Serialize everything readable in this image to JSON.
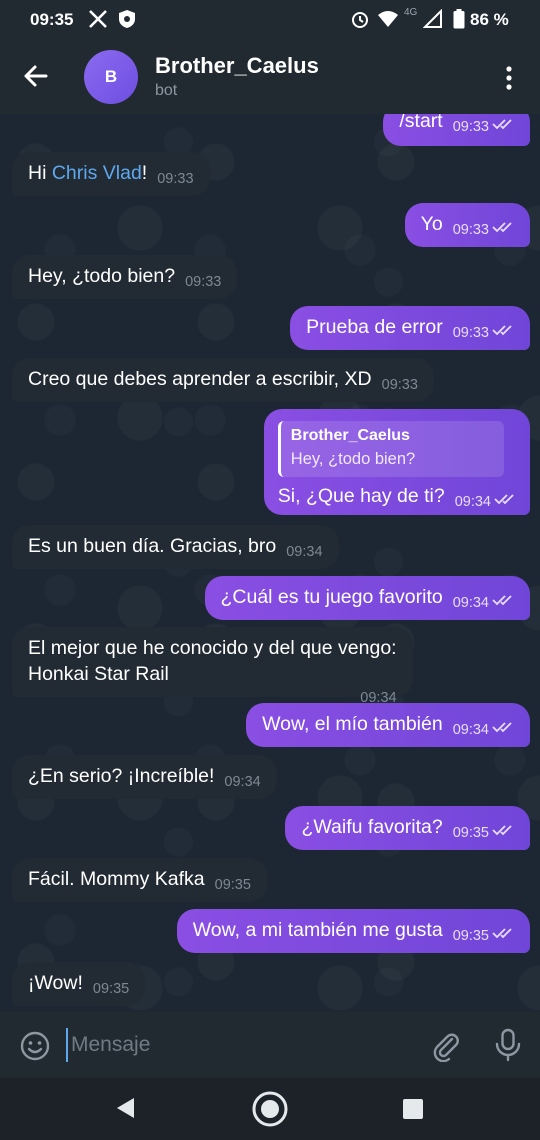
{
  "status_bar": {
    "time": "09:35",
    "network_label": "4G",
    "battery": "86 %"
  },
  "header": {
    "avatar_initial": "B",
    "title": "Brother_Caelus",
    "subtitle": "bot"
  },
  "messages": [
    {
      "dir": "out",
      "text": "/start",
      "time": "09:33",
      "read": true
    },
    {
      "dir": "in",
      "prefix": "Hi ",
      "mention": "Chris Vlad",
      "suffix": "!",
      "time": "09:33"
    },
    {
      "dir": "out",
      "text": "Yo",
      "time": "09:33",
      "read": true
    },
    {
      "dir": "in",
      "text": "Hey, ¿todo bien?",
      "time": "09:33"
    },
    {
      "dir": "out",
      "text": "Prueba de error",
      "time": "09:33",
      "read": true
    },
    {
      "dir": "in",
      "text": "Creo que debes aprender a escribir, XD",
      "time": "09:33"
    },
    {
      "dir": "out",
      "reply_name": "Brother_Caelus",
      "reply_text": "Hey, ¿todo bien?",
      "text": "Si, ¿Que hay de ti?",
      "time": "09:34",
      "read": true
    },
    {
      "dir": "in",
      "text": "Es un buen día. Gracias, bro",
      "time": "09:34"
    },
    {
      "dir": "out",
      "text": "¿Cuál es tu juego favorito",
      "time": "09:34",
      "read": true
    },
    {
      "dir": "in",
      "line1": "El mejor que he conocido y del que vengo:",
      "line2": "Honkai Star Rail",
      "time": "09:34"
    },
    {
      "dir": "out",
      "text": "Wow, el mío también",
      "time": "09:34",
      "read": true
    },
    {
      "dir": "in",
      "text": "¿En serio? ¡Increíble!",
      "time": "09:34"
    },
    {
      "dir": "out",
      "text": "¿Waifu favorita?",
      "time": "09:35",
      "read": true
    },
    {
      "dir": "in",
      "text": "Fácil. Mommy Kafka",
      "time": "09:35"
    },
    {
      "dir": "out",
      "text": "Wow, a mi también me gusta",
      "time": "09:35",
      "read": true
    },
    {
      "dir": "in",
      "text": "¡Wow!",
      "time": "09:35"
    }
  ],
  "input": {
    "placeholder": "Mensaje"
  },
  "icons": {
    "back": "arrow-left-icon",
    "menu": "more-vertical-icon",
    "emoji": "smiley-icon",
    "attach": "paperclip-icon",
    "mic": "microphone-icon",
    "read_receipt": "double-check-icon"
  },
  "colors": {
    "outgoing_bubble": "#7c4ade",
    "incoming_bubble": "#222b33",
    "mention": "#5ea8ef",
    "background": "#1d2733"
  }
}
